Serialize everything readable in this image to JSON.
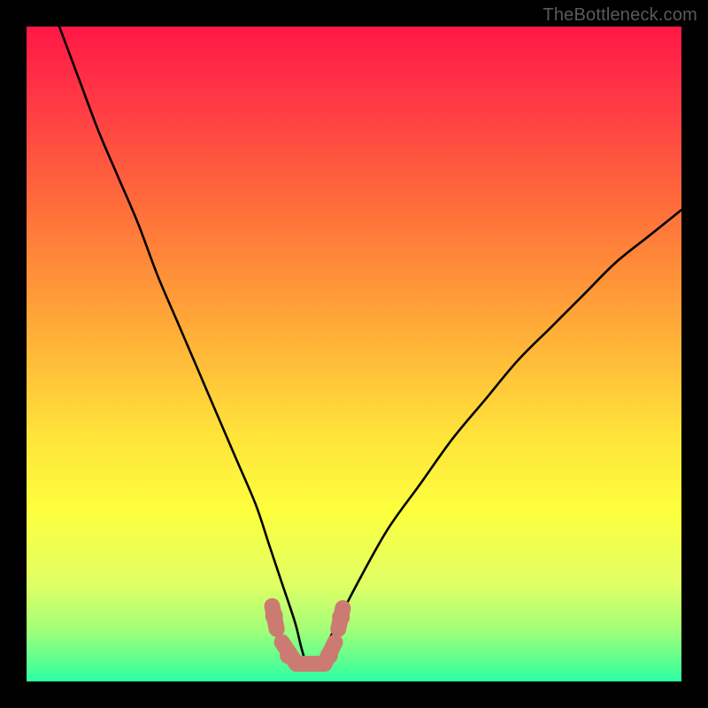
{
  "watermark": "TheBottleneck.com",
  "chart_data": {
    "type": "line",
    "title": "",
    "xlabel": "",
    "ylabel": "",
    "xlim": [
      0,
      100
    ],
    "ylim": [
      0,
      100
    ],
    "series": [
      {
        "name": "bottleneck-curve",
        "x": [
          5,
          8,
          11,
          14,
          17,
          20,
          23,
          26,
          29,
          32,
          35,
          37,
          39,
          41,
          42,
          43,
          44,
          45,
          47,
          50,
          55,
          60,
          65,
          70,
          75,
          80,
          85,
          90,
          95,
          100
        ],
        "y": [
          100,
          92,
          84,
          77,
          70,
          62,
          55,
          48,
          41,
          34,
          27,
          21,
          15,
          9,
          5,
          2,
          2,
          4,
          8,
          14,
          23,
          30,
          37,
          43,
          49,
          54,
          59,
          64,
          68,
          72
        ]
      }
    ],
    "background_gradient": {
      "stops": [
        {
          "offset": 0.0,
          "color": "#ff1845"
        },
        {
          "offset": 0.12,
          "color": "#ff3b45"
        },
        {
          "offset": 0.28,
          "color": "#ff6f3a"
        },
        {
          "offset": 0.45,
          "color": "#ffa838"
        },
        {
          "offset": 0.62,
          "color": "#ffe23a"
        },
        {
          "offset": 0.74,
          "color": "#fdff3e"
        },
        {
          "offset": 0.85,
          "color": "#e0ff64"
        },
        {
          "offset": 0.92,
          "color": "#a4ff78"
        },
        {
          "offset": 0.97,
          "color": "#5bff91"
        },
        {
          "offset": 1.0,
          "color": "#2dffa3"
        }
      ]
    },
    "overlay_band": {
      "color": "#cc7b72",
      "segments": [
        {
          "x1": 37.5,
          "y1": 11.5,
          "x2": 38.2,
          "y2": 8.0
        },
        {
          "x1": 39.0,
          "y1": 6.0,
          "x2": 41.2,
          "y2": 2.7
        },
        {
          "x1": 41.2,
          "y1": 2.7,
          "x2": 45.5,
          "y2": 2.7
        },
        {
          "x1": 45.5,
          "y1": 2.7,
          "x2": 47.1,
          "y2": 6.0
        },
        {
          "x1": 47.6,
          "y1": 8.0,
          "x2": 48.3,
          "y2": 11.2
        }
      ],
      "dots": [
        {
          "x": 37.8,
          "y": 10.0
        },
        {
          "x": 40.0,
          "y": 4.0
        },
        {
          "x": 46.2,
          "y": 4.0
        },
        {
          "x": 48.0,
          "y": 9.8
        }
      ]
    }
  }
}
